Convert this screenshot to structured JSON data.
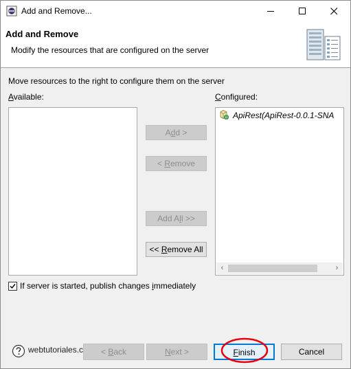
{
  "window": {
    "title": "Add and Remove...",
    "controls": [
      "minimize-icon",
      "maximize-icon",
      "close-icon"
    ]
  },
  "banner": {
    "title": "Add and Remove",
    "subtitle": "Modify the resources that are configured on the server",
    "icon": "server-icon"
  },
  "instructions": "Move resources to the right to configure them on the server",
  "available": {
    "label_mnemonic": "A",
    "label_rest": "vailable:",
    "items": []
  },
  "configured": {
    "label_mnemonic": "C",
    "label_rest": "onfigured:",
    "items": [
      {
        "label": "ApiRest(ApiRest-0.0.1-SNA",
        "icon": "web-project-icon"
      }
    ]
  },
  "buttons": {
    "add": {
      "pre": "A",
      "mn": "d",
      "post": "d >",
      "enabled": false
    },
    "remove": {
      "pre": "< ",
      "mn": "R",
      "post": "emove",
      "enabled": false
    },
    "add_all": {
      "pre": "Add A",
      "mn": "l",
      "post": "l >>",
      "enabled": false
    },
    "remove_all": {
      "pre": "<< ",
      "mn": "R",
      "post": "emove All",
      "enabled": true
    }
  },
  "publish_checkbox": {
    "checked": true,
    "label_pre": "If server is started, publish changes ",
    "label_mn": "i",
    "label_post": "mmediately"
  },
  "footer": {
    "help_icon": "help-icon",
    "watermark": "webtutoriales.com",
    "back": {
      "pre": "< ",
      "mn": "B",
      "post": "ack",
      "enabled": false
    },
    "next": {
      "pre": "",
      "mn": "N",
      "post": "ext >",
      "enabled": false
    },
    "finish": {
      "pre": "",
      "mn": "F",
      "post": "inish",
      "enabled": true
    },
    "cancel": {
      "label": "Cancel",
      "enabled": true
    }
  },
  "colors": {
    "annotation": "#e8000b",
    "focus": "#0078d7",
    "dialog_bg": "#f0f0f0"
  }
}
